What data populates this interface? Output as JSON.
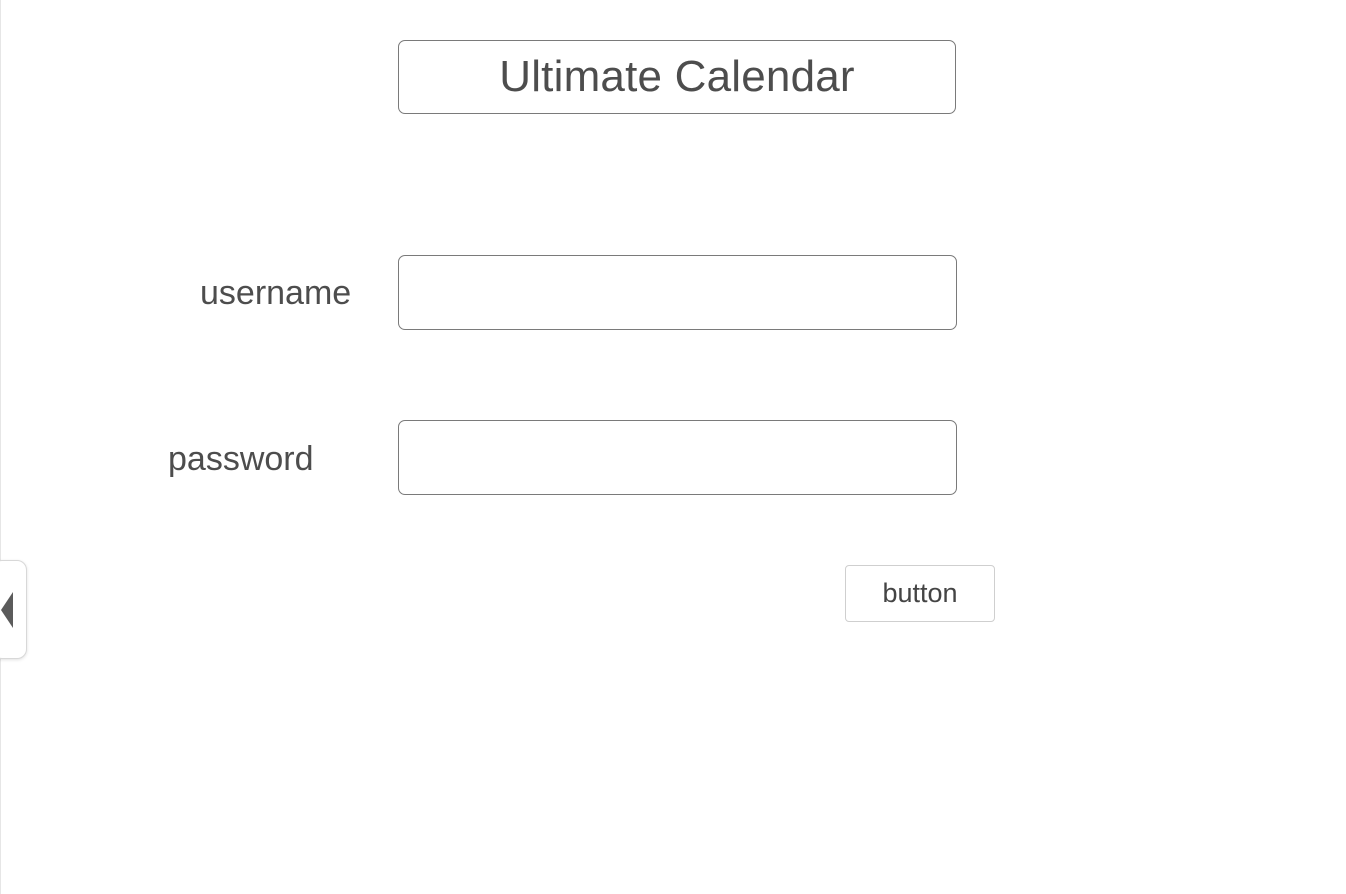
{
  "app": {
    "title": "Ultimate Calendar"
  },
  "login_form": {
    "username_label": "username",
    "username_value": "",
    "password_label": "password",
    "password_value": "",
    "submit_label": "button"
  },
  "side_panel": {
    "toggle_icon": "chevron-left-icon"
  },
  "colors": {
    "border": "#7a7a7a",
    "text": "#4d4d4d",
    "background": "#ffffff"
  }
}
